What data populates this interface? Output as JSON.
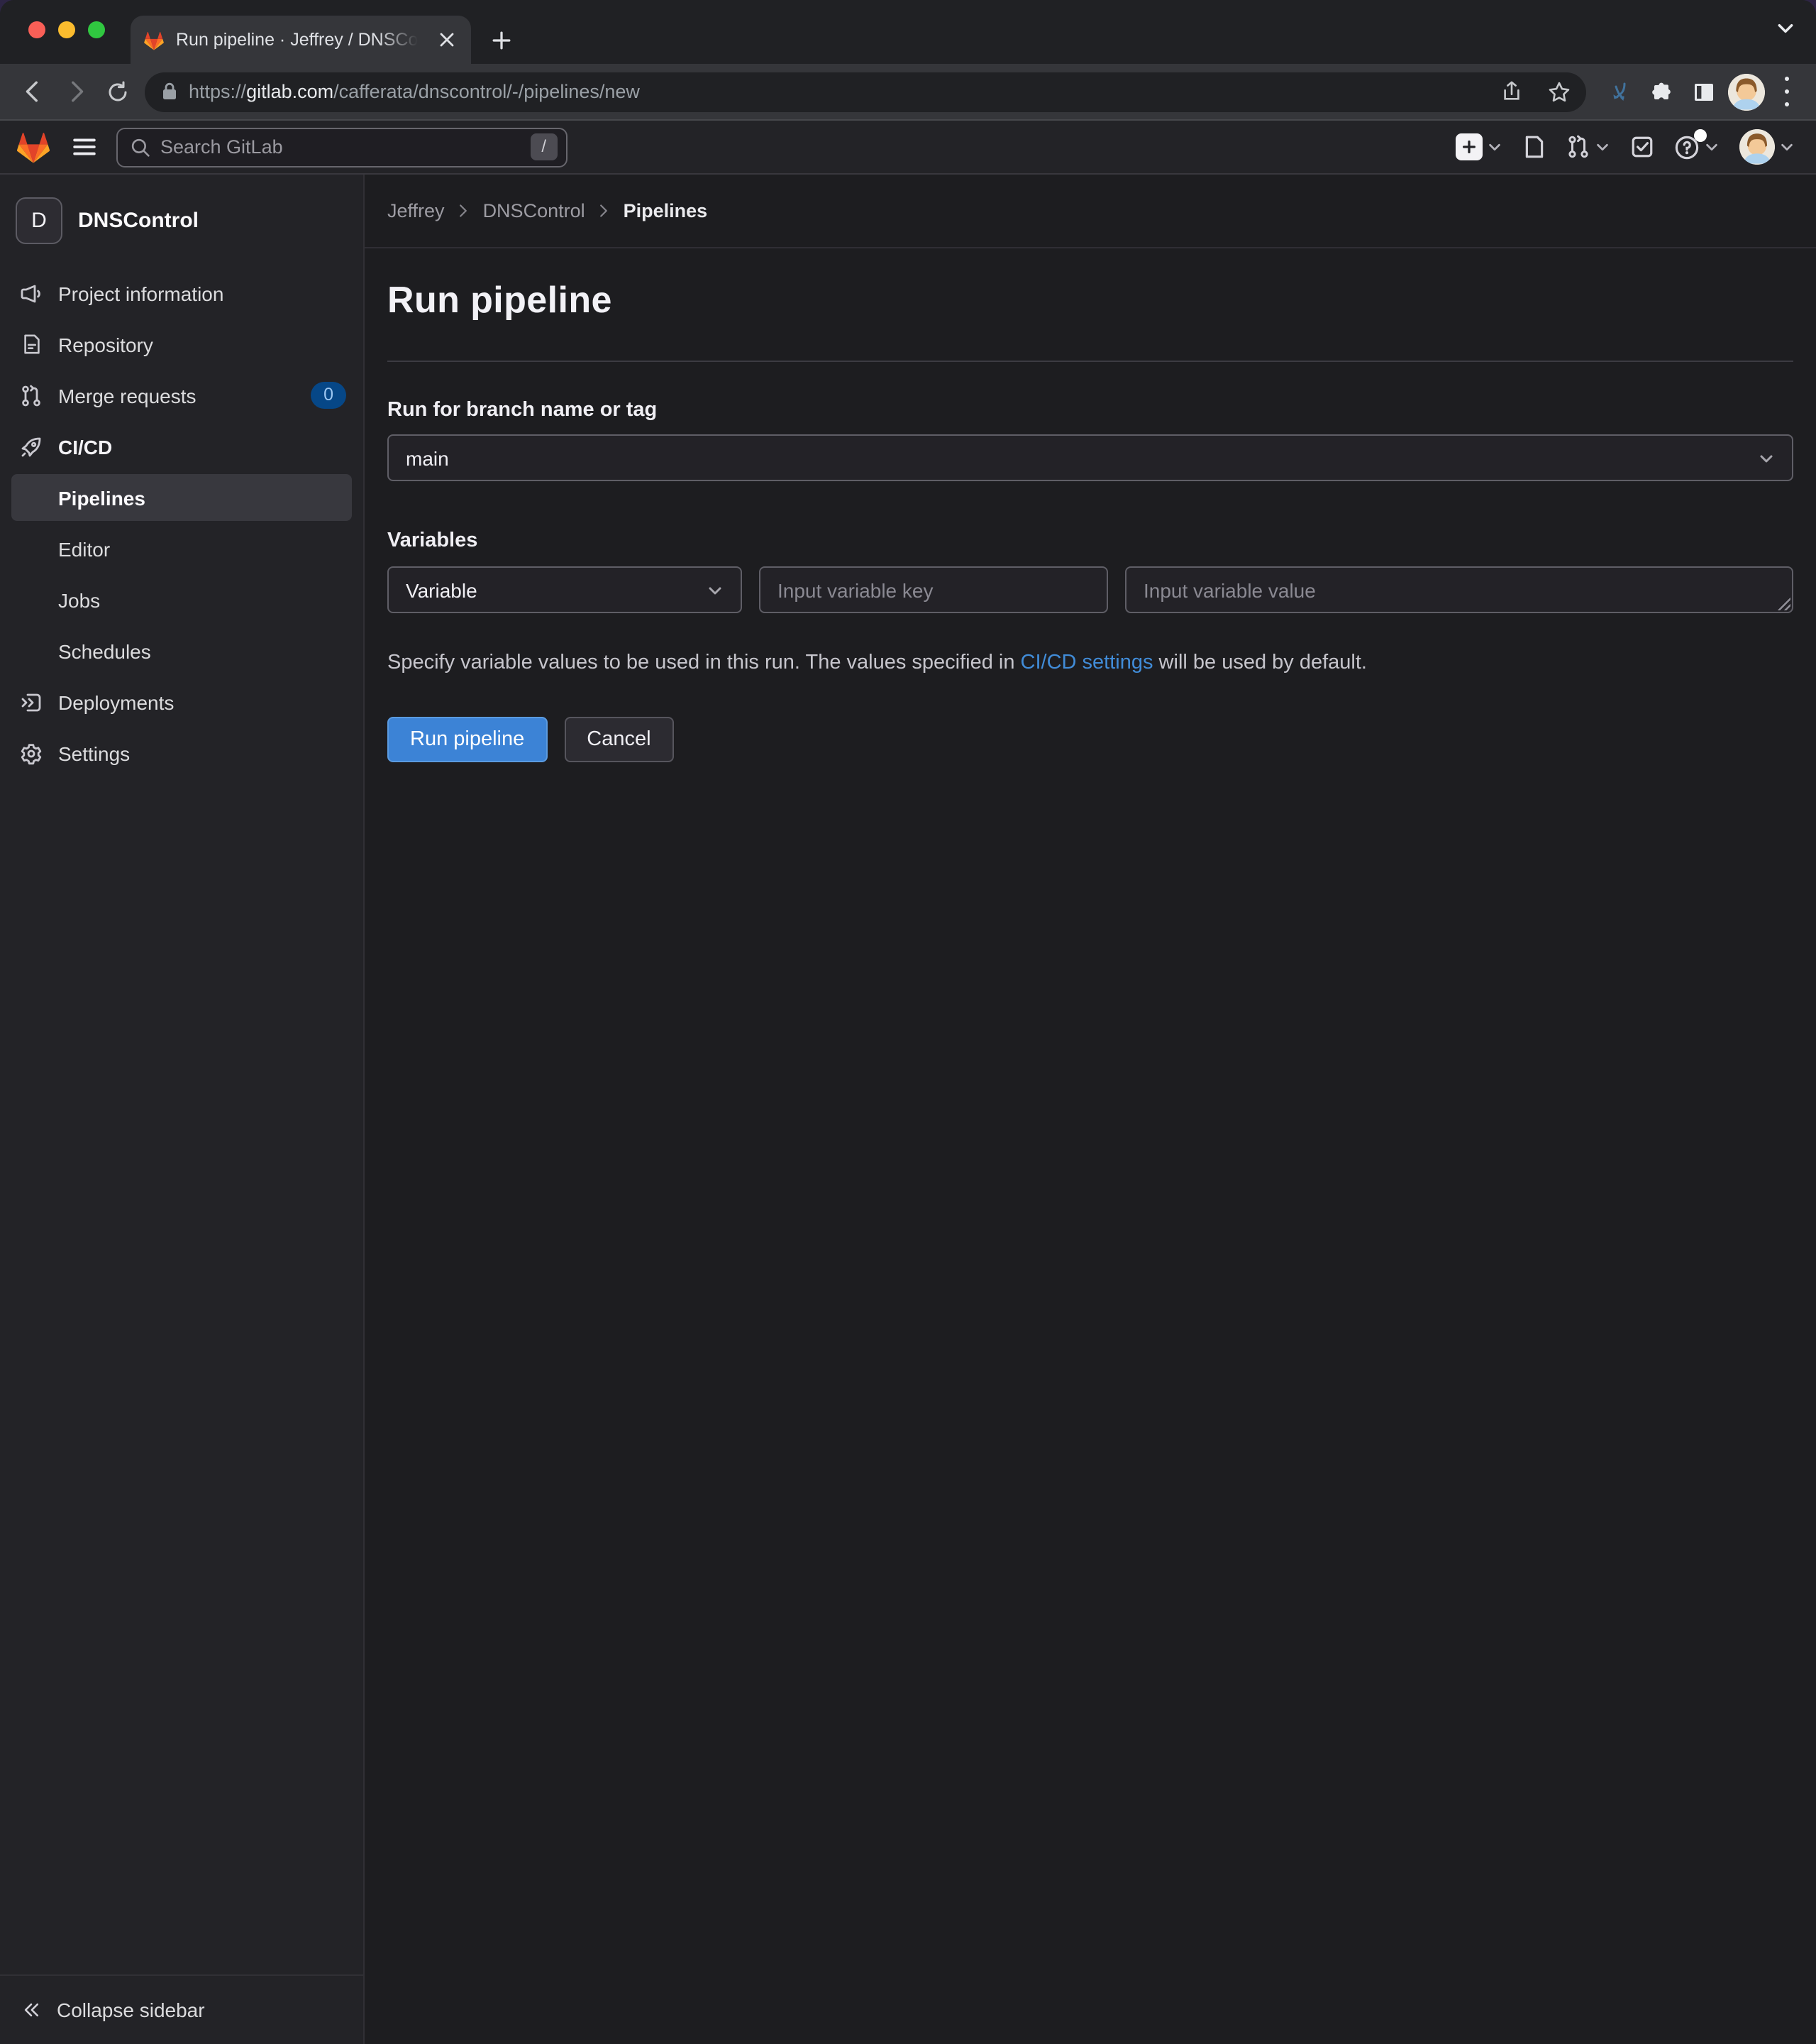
{
  "browser": {
    "tab_title": "Run pipeline · Jeffrey / DNSCon",
    "url": {
      "scheme": "https://",
      "host": "gitlab.com",
      "path": "/cafferata/dnscontrol/-/pipelines/new"
    }
  },
  "gitlab_header": {
    "search_placeholder": "Search GitLab",
    "search_shortcut": "/"
  },
  "sidebar": {
    "project": {
      "initial": "D",
      "name": "DNSControl"
    },
    "items": [
      {
        "label": "Project information"
      },
      {
        "label": "Repository"
      },
      {
        "label": "Merge requests",
        "badge": "0"
      },
      {
        "label": "CI/CD"
      },
      {
        "label": "Pipelines"
      },
      {
        "label": "Editor"
      },
      {
        "label": "Jobs"
      },
      {
        "label": "Schedules"
      },
      {
        "label": "Deployments"
      },
      {
        "label": "Settings"
      }
    ],
    "collapse_label": "Collapse sidebar"
  },
  "breadcrumb": {
    "items": [
      {
        "label": "Jeffrey"
      },
      {
        "label": "DNSControl"
      },
      {
        "label": "Pipelines"
      }
    ]
  },
  "main": {
    "title": "Run pipeline",
    "branch_label": "Run for branch name or tag",
    "branch_value": "main",
    "variables_label": "Variables",
    "variable_type_value": "Variable",
    "key_placeholder": "Input variable key",
    "value_placeholder": "Input variable value",
    "helper_prefix": "Specify variable values to be used in this run. The values specified in ",
    "helper_link": "CI/CD settings",
    "helper_suffix": " will be used by default.",
    "run_button": "Run pipeline",
    "cancel_button": "Cancel"
  },
  "colors": {
    "primary_button": "#3c83d6",
    "link": "#418cd8",
    "badge_bg": "#064787",
    "badge_text": "#9dc7f1",
    "gitlab_logo_red": "#e24329",
    "gitlab_logo_orange": "#fc6d26",
    "gitlab_logo_yellow": "#fca326"
  }
}
